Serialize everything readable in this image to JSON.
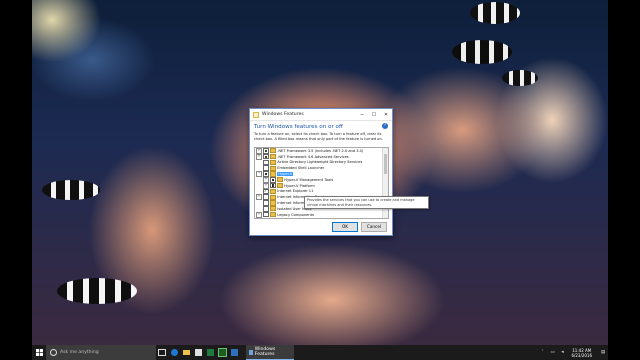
{
  "dialog": {
    "title": "Windows Features",
    "minimize": "─",
    "maximize": "☐",
    "close": "✕",
    "heading": "Turn Windows features on or off",
    "help": "?",
    "description": "To turn a feature on, select its check box. To turn a feature off, clear its check box. A filled box means that only part of the feature is turned on.",
    "features": [
      {
        "label": ".NET Framework 3.5 (includes .NET 2.0 and 3.0)",
        "indent": 0,
        "expander": "+",
        "state": "partial"
      },
      {
        "label": ".NET Framework 4.6 Advanced Services",
        "indent": 0,
        "expander": "+",
        "state": "partial"
      },
      {
        "label": "Active Directory Lightweight Directory Services",
        "indent": 0,
        "expander": "",
        "state": "empty"
      },
      {
        "label": "Embedded Shell Launcher",
        "indent": 0,
        "expander": "",
        "state": "empty"
      },
      {
        "label": "Hyper-V",
        "indent": 0,
        "expander": "−",
        "state": "full",
        "selected": true
      },
      {
        "label": "Hyper-V Management Tools",
        "indent": 1,
        "expander": "+",
        "state": "full"
      },
      {
        "label": "Hyper-V Platform",
        "indent": 1,
        "expander": "+",
        "state": "full"
      },
      {
        "label": "Internet Explorer 11",
        "indent": 0,
        "expander": "",
        "state": "checked"
      },
      {
        "label": "Internet Information Services",
        "indent": 0,
        "expander": "+",
        "state": "empty"
      },
      {
        "label": "Internet Information Services Hostable Web Core",
        "indent": 0,
        "expander": "",
        "state": "empty"
      },
      {
        "label": "Isolated User Mode",
        "indent": 0,
        "expander": "",
        "state": "empty"
      },
      {
        "label": "Legacy Components",
        "indent": 0,
        "expander": "+",
        "state": "empty"
      }
    ],
    "tooltip": "Provides the services that you can use to create and manage virtual machines and their resources.",
    "ok_label": "OK",
    "cancel_label": "Cancel"
  },
  "taskbar": {
    "search_placeholder": "Ask me anything",
    "active_app": "Windows Features",
    "clock_time": "11:42 AM",
    "clock_date": "6/23/2016",
    "pinned": [
      "task-view-icon",
      "edge-icon",
      "file-explorer-icon",
      "store-icon",
      "excel-icon",
      "onenote-icon",
      "control-panel-icon"
    ]
  },
  "colors": {
    "accent": "#0078d7",
    "heading_blue": "#1a56a8",
    "selection": "#3399ff",
    "taskbar": "#1b1b1b"
  }
}
